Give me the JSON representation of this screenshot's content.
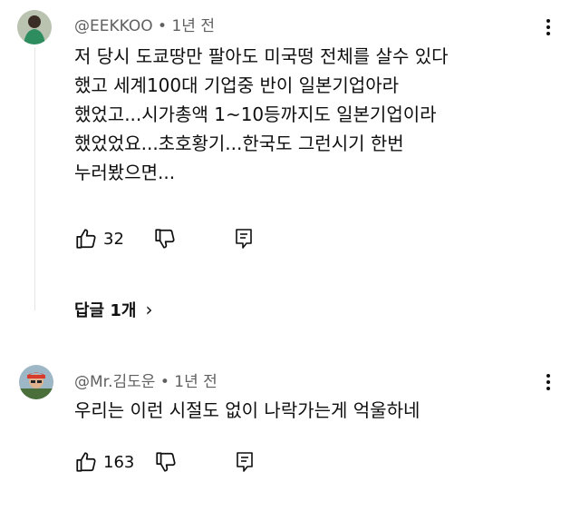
{
  "comments": [
    {
      "author": "@EEKKOO",
      "time": "1년 전",
      "text_lines": [
        "저 당시 도쿄땅만 팔아도 미국떵 전체를 살수 있다",
        "했고 세계100대 기업중 반이 일본기업아라",
        "했었고...시가총액 1~10등까지도 일본기업이라",
        "했었었요...초호황기...한국도 그런시기 한번",
        "누러봤으면..."
      ],
      "likes": "32",
      "icons": [
        "like-icon",
        "dislike-icon",
        "reply-icon",
        "more-vert-icon"
      ]
    },
    {
      "author": "@Mr.김도운",
      "time": "1년 전",
      "text_lines": [
        "우리는 이런 시절도 없이 나락가는게 억울하네"
      ],
      "likes": "163",
      "icons": [
        "like-icon",
        "dislike-icon",
        "reply-icon",
        "more-vert-icon"
      ]
    }
  ],
  "replies_label": "답글 1개",
  "separator": "•",
  "colors": {
    "meta": "#606060",
    "text": "#0f0f0f",
    "thread": "#e5e5e5"
  }
}
